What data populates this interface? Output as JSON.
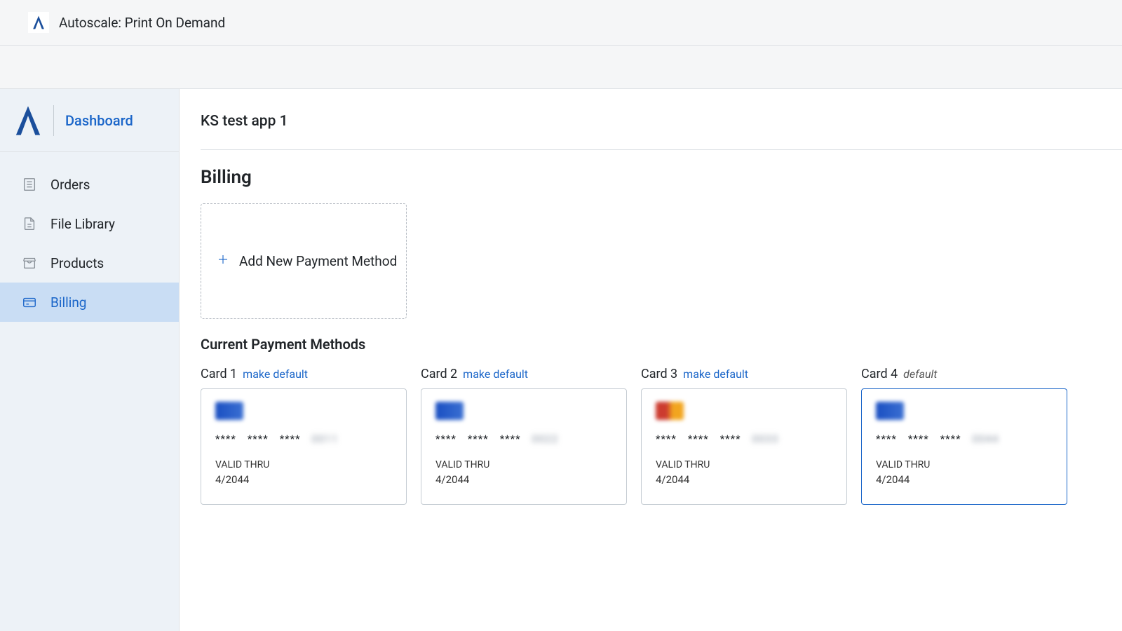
{
  "header": {
    "title": "Autoscale: Print On Demand"
  },
  "sidebar": {
    "top_label": "Dashboard",
    "items": [
      {
        "label": "Orders"
      },
      {
        "label": "File Library"
      },
      {
        "label": "Products"
      },
      {
        "label": "Billing"
      }
    ]
  },
  "main": {
    "app_name": "KS test app 1",
    "section_title": "Billing",
    "add_payment_label": "Add New Payment Method",
    "current_methods_title": "Current Payment Methods",
    "make_default_label": "make default",
    "default_label": "default",
    "valid_thru_label": "VALID THRU",
    "mask_group": "****",
    "cards": [
      {
        "title": "Card 1",
        "brand": "visa",
        "last4": "0011",
        "exp": "4/2044",
        "is_default": false
      },
      {
        "title": "Card 2",
        "brand": "visa",
        "last4": "0022",
        "exp": "4/2044",
        "is_default": false
      },
      {
        "title": "Card 3",
        "brand": "mc",
        "last4": "0033",
        "exp": "4/2044",
        "is_default": false
      },
      {
        "title": "Card 4",
        "brand": "visa",
        "last4": "0044",
        "exp": "4/2044",
        "is_default": true
      }
    ]
  }
}
